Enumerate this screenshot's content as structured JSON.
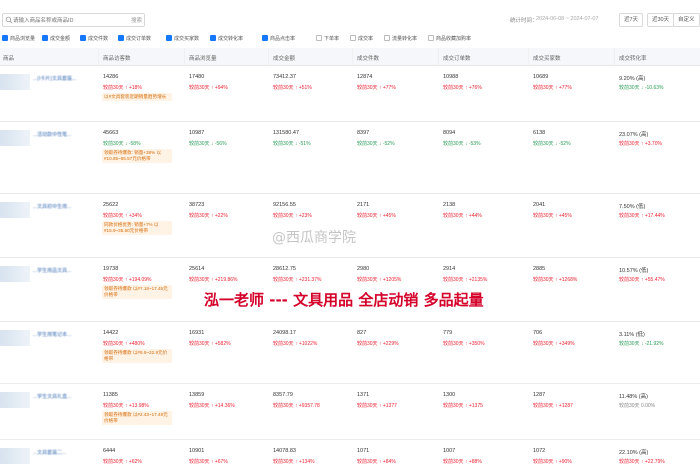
{
  "toolbar": {
    "search_placeholder": "请输入商品名称或商品ID",
    "search_button": "搜索",
    "date_label": "统计时间：",
    "date_range": "2024-06-08 ~ 2024-07-07",
    "periods": [
      "近7天",
      "近30天",
      "自定义"
    ]
  },
  "filters": [
    {
      "label": "商品浏览量",
      "checked": true
    },
    {
      "label": "成交金额",
      "checked": true
    },
    {
      "label": "成交件数",
      "checked": true
    },
    {
      "label": "成交订单数",
      "checked": true
    },
    {
      "label": "成交买家数",
      "checked": true
    },
    {
      "label": "成交转化率",
      "checked": true
    },
    {
      "label": "商品点击率",
      "checked": true
    },
    {
      "label": "下单率",
      "checked": false
    },
    {
      "label": "成交率",
      "checked": false
    },
    {
      "label": "流量转化率",
      "checked": false
    },
    {
      "label": "商品收藏加购率",
      "checked": false
    }
  ],
  "table": {
    "headers": [
      "商品",
      "商品访客数",
      "商品浏览量",
      "成交金额",
      "成交件数",
      "成交订单数",
      "成交买家数",
      "成交转化率"
    ],
    "rows": [
      {
        "name": "...(Ⅰ卡片)文具套装...",
        "tag": "以#文具套装近期销量趋势增长",
        "cells": [
          {
            "v": "14286",
            "c": "较前30天 ↑ +18%",
            "d": "up"
          },
          {
            "v": "17480",
            "c": "较前30天 ↑ +94%",
            "d": "up"
          },
          {
            "v": "73412.37",
            "c": "较前30天 ↑ +51%",
            "d": "up"
          },
          {
            "v": "12874",
            "c": "较前30天 ↑ +77%",
            "d": "up"
          },
          {
            "v": "10988",
            "c": "较前30天 ↑ +76%",
            "d": "up"
          },
          {
            "v": "10689",
            "c": "较前30天 ↑ +77%",
            "d": "up"
          },
          {
            "v": "9.20% (高)",
            "c": "较前30天 ↓ -10.63%",
            "d": "down"
          }
        ]
      },
      {
        "name": "...活动款中性笔...",
        "tag": "领取券待爆款: 销量+38% 以#10.85~55.57元价格带",
        "cells": [
          {
            "v": "45663",
            "c": "较前30天 ↓ -58%",
            "d": "down"
          },
          {
            "v": "10987",
            "c": "较前30天 ↓ -56%",
            "d": "down"
          },
          {
            "v": "131580.47",
            "c": "较前30天 ↓ -51%",
            "d": "down"
          },
          {
            "v": "8397",
            "c": "较前30天 ↓ -52%",
            "d": "down"
          },
          {
            "v": "8094",
            "c": "较前30天 ↓ -53%",
            "d": "down"
          },
          {
            "v": "6138",
            "c": "较前30天 ↓ -52%",
            "d": "down"
          },
          {
            "v": "23.07% (高)",
            "c": "较前30天 ↑ +3.70%",
            "d": "up"
          }
        ]
      },
      {
        "name": "...文具初中生用...",
        "tag": "同款价格优势: 销量+7% 以#15.9~35.60元价格带",
        "cells": [
          {
            "v": "25622",
            "c": "较前30天 ↑ +34%",
            "d": "up"
          },
          {
            "v": "38723",
            "c": "较前30天 ↑ +22%",
            "d": "up"
          },
          {
            "v": "92156.55",
            "c": "较前30天 ↑ +23%",
            "d": "up"
          },
          {
            "v": "2171",
            "c": "较前30天 ↑ +45%",
            "d": "up"
          },
          {
            "v": "2138",
            "c": "较前30天 ↑ +44%",
            "d": "up"
          },
          {
            "v": "2041",
            "c": "较前30天 ↑ +45%",
            "d": "up"
          },
          {
            "v": "7.50% (低)",
            "c": "较前30天 ↑ +17.44%",
            "d": "up"
          }
        ]
      },
      {
        "name": "...学生用品文具...",
        "tag": "领取券待爆款 以#7.18~17.45元价格带",
        "cells": [
          {
            "v": "19738",
            "c": "较前30天 ↑ +194.09%",
            "d": "up"
          },
          {
            "v": "25614",
            "c": "较前30天 ↑ +219.86%",
            "d": "up"
          },
          {
            "v": "28612.75",
            "c": "较前30天 ↑ +231.37%",
            "d": "up"
          },
          {
            "v": "2980",
            "c": "较前30天 ↑ +1205%",
            "d": "up"
          },
          {
            "v": "2914",
            "c": "较前30天 ↑ +2135%",
            "d": "up"
          },
          {
            "v": "2885",
            "c": "较前30天 ↑ +1268%",
            "d": "up"
          },
          {
            "v": "10.57% (低)",
            "c": "较前30天 ↑ +55.47%",
            "d": "up"
          }
        ]
      },
      {
        "name": "...学生用笔记本...",
        "tag": "领取券待爆款 以#9.9~32.9元价格带",
        "cells": [
          {
            "v": "14422",
            "c": "较前30天 ↑ +480%",
            "d": "up"
          },
          {
            "v": "16931",
            "c": "较前30天 ↑ +582%",
            "d": "up"
          },
          {
            "v": "24098.17",
            "c": "较前30天 ↑ +1022%",
            "d": "up"
          },
          {
            "v": "827",
            "c": "较前30天 ↑ +229%",
            "d": "up"
          },
          {
            "v": "779",
            "c": "较前30天 ↑ +350%",
            "d": "up"
          },
          {
            "v": "706",
            "c": "较前30天 ↑ +349%",
            "d": "up"
          },
          {
            "v": "3.11% (低)",
            "c": "较前30天 ↓ -21.92%",
            "d": "down"
          }
        ]
      },
      {
        "name": "...学生文具礼盒...",
        "tag": "领取券待爆款 以#2.43~17.49元价格带",
        "cells": [
          {
            "v": "11385",
            "c": "较前30天 ↑ +13.98%",
            "d": "up"
          },
          {
            "v": "13859",
            "c": "较前30天 ↑ +14.36%",
            "d": "up"
          },
          {
            "v": "8357.79",
            "c": "较前30天 ↑ +9357.78",
            "d": "up"
          },
          {
            "v": "1371",
            "c": "较前30天 ↑ +1377",
            "d": "up"
          },
          {
            "v": "1300",
            "c": "较前30天 ↑ +1375",
            "d": "up"
          },
          {
            "v": "1287",
            "c": "较前30天 ↑ +1287",
            "d": "up"
          },
          {
            "v": "11.48% (高)",
            "c": "较前30天 0.00%",
            "d": "flat"
          }
        ]
      },
      {
        "name": "...文具套装二...",
        "tag": "",
        "cells": [
          {
            "v": "6444",
            "c": "较前30天 ↑ +62%",
            "d": "up"
          },
          {
            "v": "10901",
            "c": "较前30天 ↑ +67%",
            "d": "up"
          },
          {
            "v": "14078.83",
            "c": "较前30天 ↑ +134%",
            "d": "up"
          },
          {
            "v": "1071",
            "c": "较前30天 ↑ +84%",
            "d": "up"
          },
          {
            "v": "1007",
            "c": "较前30天 ↑ +88%",
            "d": "up"
          },
          {
            "v": "1072",
            "c": "较前30天 ↑ +90%",
            "d": "up"
          },
          {
            "v": "22.10% (高)",
            "c": "较前30天 ↑ +22.79%",
            "d": "up"
          }
        ]
      }
    ]
  },
  "watermark": "@西瓜商学院",
  "overlay_caption": "泓一老师 --- 文具用品 全店动销 多品起量",
  "colors": {
    "accent": "#1677ff",
    "up": "#e23333",
    "down": "#2a9d57",
    "overlay": "#d4002a"
  }
}
